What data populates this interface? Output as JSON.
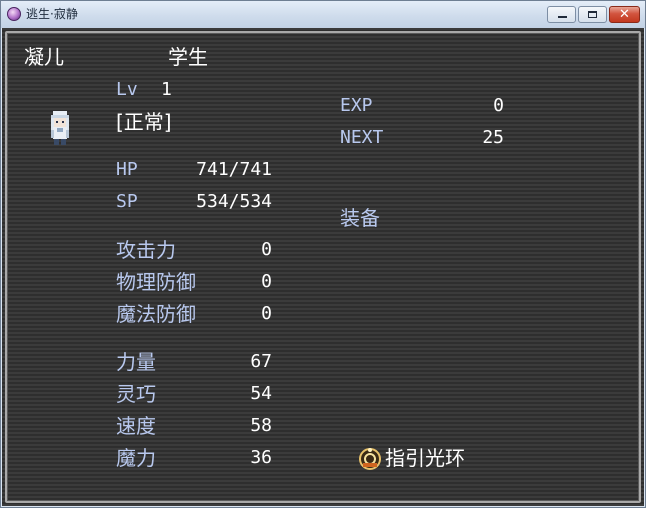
{
  "window": {
    "title": "逃生·寂静"
  },
  "status": {
    "name": "凝儿",
    "class": "学生",
    "level_label": "Lv",
    "level": "1",
    "state": "[正常]",
    "hp_label": "HP",
    "hp": "741/741",
    "sp_label": "SP",
    "sp": "534/534",
    "exp_label": "EXP",
    "exp": "0",
    "next_label": "NEXT",
    "next": "25",
    "equip_label": "装备",
    "stats": [
      {
        "label": "攻击力",
        "value": "0"
      },
      {
        "label": "物理防御",
        "value": "0"
      },
      {
        "label": "魔法防御",
        "value": "0"
      },
      {
        "label": "力量",
        "value": "67"
      },
      {
        "label": "灵巧",
        "value": "54"
      },
      {
        "label": "速度",
        "value": "58"
      },
      {
        "label": "魔力",
        "value": "36"
      }
    ],
    "equipment": [
      {
        "name": "指引光环",
        "icon": "halo-ring-icon"
      }
    ]
  }
}
